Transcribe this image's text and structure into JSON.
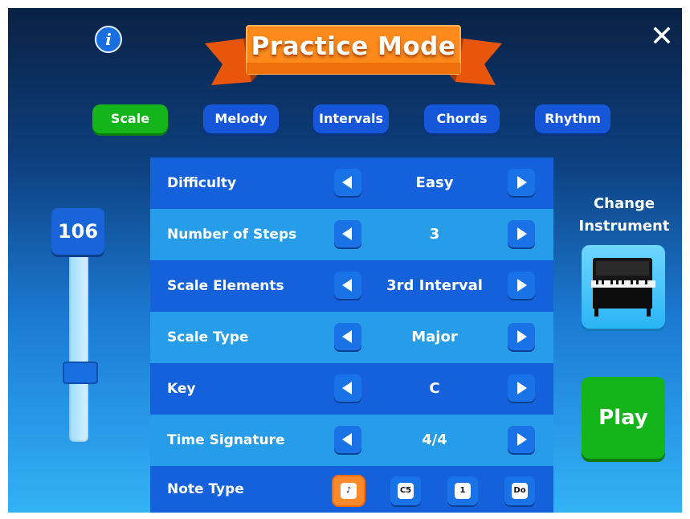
{
  "header": {
    "title": "Practice Mode",
    "info_icon": "info-icon",
    "close_icon": "close-icon"
  },
  "tabs": [
    {
      "label": "Scale",
      "active": true
    },
    {
      "label": "Melody",
      "active": false
    },
    {
      "label": "Intervals",
      "active": false
    },
    {
      "label": "Chords",
      "active": false
    },
    {
      "label": "Rhythm",
      "active": false
    }
  ],
  "tempo": {
    "value": "106"
  },
  "settings": [
    {
      "label": "Difficulty",
      "value": "Easy"
    },
    {
      "label": "Number of Steps",
      "value": "3"
    },
    {
      "label": "Scale Elements",
      "value": "3rd Interval"
    },
    {
      "label": "Scale Type",
      "value": "Major"
    },
    {
      "label": "Key",
      "value": "C"
    },
    {
      "label": "Time Signature",
      "value": "4/4"
    }
  ],
  "note_type": {
    "label": "Note Type",
    "options": [
      {
        "icon": "note-staff-icon",
        "text": "♪",
        "selected": true
      },
      {
        "icon": "letter-name-icon",
        "text": "C5",
        "selected": false
      },
      {
        "icon": "number-icon",
        "text": "1",
        "selected": false
      },
      {
        "icon": "solfege-icon",
        "text": "Do",
        "selected": false
      }
    ]
  },
  "instrument": {
    "label": "Change Instrument",
    "icon": "piano-icon"
  },
  "play": {
    "label": "Play"
  },
  "colors": {
    "active_tab": "#13b51a",
    "tab": "#1557d8",
    "banner": "#ff8a1c",
    "play": "#13b51a"
  }
}
